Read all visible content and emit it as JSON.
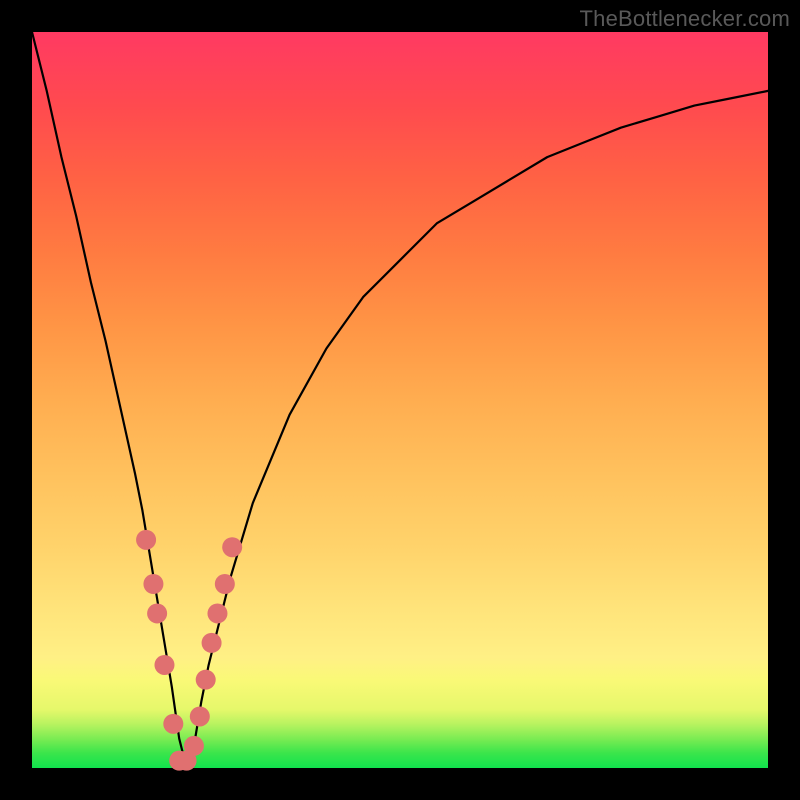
{
  "watermark": "TheBottlenecker.com",
  "colors": {
    "curve": "#000000",
    "markers": "#e07070",
    "gradient_top": "#ff3a62",
    "gradient_bottom": "#11e24d"
  },
  "chart_data": {
    "type": "line",
    "title": "",
    "xlabel": "",
    "ylabel": "",
    "xlim": [
      0,
      100
    ],
    "ylim": [
      0,
      100
    ],
    "curve": {
      "x": [
        0,
        2,
        4,
        6,
        8,
        10,
        12,
        14,
        15,
        16,
        17,
        18,
        19,
        20,
        21,
        22,
        23,
        24,
        25,
        27,
        30,
        35,
        40,
        45,
        50,
        55,
        60,
        65,
        70,
        75,
        80,
        85,
        90,
        95,
        100
      ],
      "y": [
        100,
        92,
        83,
        75,
        66,
        58,
        49,
        40,
        35,
        29,
        23,
        17,
        11,
        4,
        0,
        3,
        9,
        14,
        18,
        26,
        36,
        48,
        57,
        64,
        69,
        74,
        77,
        80,
        83,
        85,
        87,
        88.5,
        90,
        91,
        92
      ]
    },
    "markers": [
      {
        "x": 15.5,
        "y": 31
      },
      {
        "x": 16.5,
        "y": 25
      },
      {
        "x": 17.0,
        "y": 21
      },
      {
        "x": 18.0,
        "y": 14
      },
      {
        "x": 19.2,
        "y": 6
      },
      {
        "x": 20.0,
        "y": 1
      },
      {
        "x": 21.0,
        "y": 1
      },
      {
        "x": 22.0,
        "y": 3
      },
      {
        "x": 22.8,
        "y": 7
      },
      {
        "x": 23.6,
        "y": 12
      },
      {
        "x": 24.4,
        "y": 17
      },
      {
        "x": 25.2,
        "y": 21
      },
      {
        "x": 26.2,
        "y": 25
      },
      {
        "x": 27.2,
        "y": 30
      }
    ]
  }
}
